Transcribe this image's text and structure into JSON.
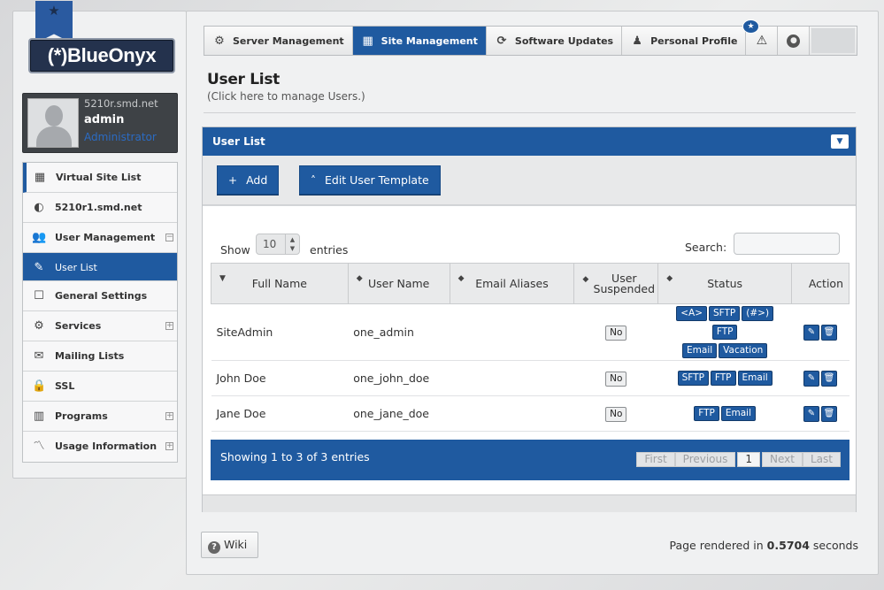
{
  "brand": {
    "logo_text": "(*)BlueOnyx"
  },
  "user": {
    "host": "5210r.smd.net",
    "name": "admin",
    "role": "Administrator"
  },
  "sidebar": {
    "items": [
      {
        "label": "Virtual Site List",
        "icon": "site-list-icon"
      },
      {
        "label": "5210r1.smd.net",
        "icon": "globe-icon"
      },
      {
        "label": "User Management",
        "icon": "users-icon",
        "expander": "−"
      },
      {
        "label": "User List",
        "icon": "pencil-icon",
        "active": true
      },
      {
        "label": "General Settings",
        "icon": "edit-icon"
      },
      {
        "label": "Services",
        "icon": "gear-icon",
        "expander": "+"
      },
      {
        "label": "Mailing Lists",
        "icon": "envelope-icon"
      },
      {
        "label": "SSL",
        "icon": "lock-icon"
      },
      {
        "label": "Programs",
        "icon": "programs-icon",
        "expander": "+"
      },
      {
        "label": "Usage Information",
        "icon": "chart-icon",
        "expander": "+"
      }
    ]
  },
  "topbar": {
    "tabs": [
      {
        "label": "Server Management",
        "icon": "gear-icon"
      },
      {
        "label": "Site Management",
        "icon": "grid-icon",
        "active": true
      },
      {
        "label": "Software Updates",
        "icon": "refresh-icon"
      },
      {
        "label": "Personal Profile",
        "icon": "person-icon"
      }
    ],
    "notification_count": "★"
  },
  "page": {
    "title": "User List",
    "subtitle": "(Click here to manage Users.)"
  },
  "panel": {
    "title": "User List",
    "add_label": "Add",
    "template_label": "Edit User Template",
    "show_label": "Show",
    "entries_value": "10",
    "entries_label": "entries",
    "search_label": "Search:",
    "search_placeholder": ""
  },
  "table": {
    "columns": [
      "Full Name",
      "User Name",
      "Email Aliases",
      "User Suspended",
      "Status",
      "Action"
    ],
    "rows": [
      {
        "full_name": "SiteAdmin",
        "user_name": "one_admin",
        "email_aliases": "",
        "suspended": "No",
        "status": [
          "<A>",
          "SFTP",
          "(#>)",
          "FTP",
          "Email",
          "Vacation"
        ]
      },
      {
        "full_name": "John Doe",
        "user_name": "one_john_doe",
        "email_aliases": "",
        "suspended": "No",
        "status": [
          "SFTP",
          "FTP",
          "Email"
        ]
      },
      {
        "full_name": "Jane Doe",
        "user_name": "one_jane_doe",
        "email_aliases": "",
        "suspended": "No",
        "status": [
          "FTP",
          "Email"
        ]
      }
    ],
    "footer_info": "Showing 1 to 3 of 3 entries",
    "pager": {
      "first": "First",
      "previous": "Previous",
      "current": "1",
      "next": "Next",
      "last": "Last"
    }
  },
  "footer": {
    "wiki_label": "Wiki",
    "rendered_prefix": "Page rendered in",
    "rendered_time": "0.5704",
    "rendered_suffix": "seconds"
  },
  "colors": {
    "accent": "#1f5aa0",
    "dark": "#3e4246"
  }
}
